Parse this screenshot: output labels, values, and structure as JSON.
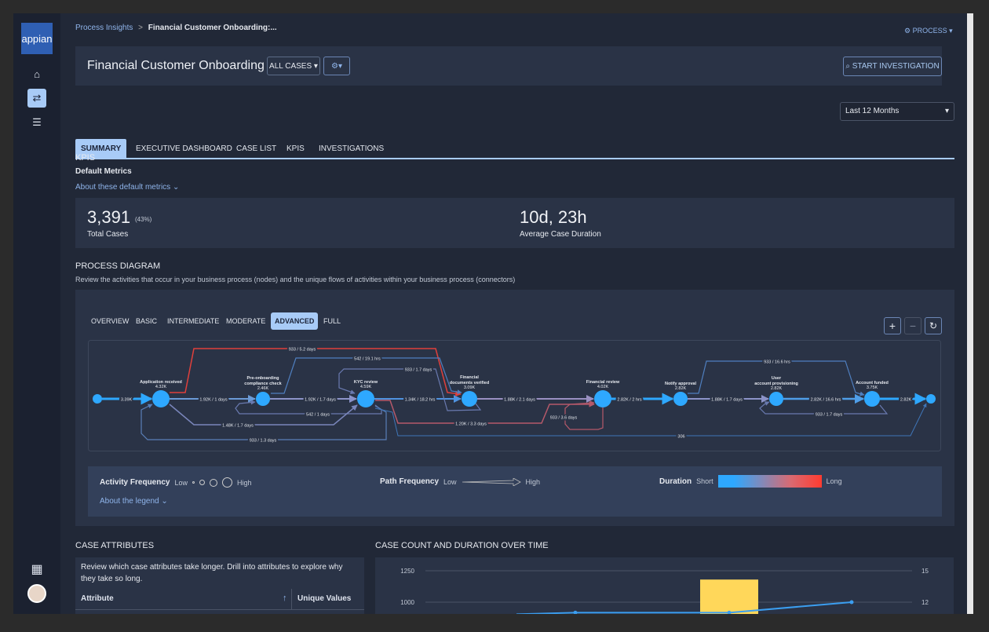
{
  "sidebar": {
    "logo": "appian",
    "items": [
      {
        "icon": "home-icon"
      },
      {
        "icon": "process-flow-icon",
        "active": true
      },
      {
        "icon": "database-icon"
      }
    ],
    "bottom": [
      {
        "icon": "apps-grid-icon"
      },
      {
        "icon": "user-avatar"
      }
    ]
  },
  "breadcrumb": {
    "parent": "Process Insights",
    "separator": ">",
    "current": "Financial Customer Onboarding:..."
  },
  "process_menu": "PROCESS",
  "header": {
    "title": "Financial Customer Onboarding",
    "filter": "ALL CASES",
    "start_investigation": "START INVESTIGATION"
  },
  "date_range": {
    "selected": "Last 12 Months"
  },
  "tabs": [
    {
      "label": "SUMMARY",
      "active": true
    },
    {
      "label": "EXECUTIVE DASHBOARD"
    },
    {
      "label": "CASE LIST"
    },
    {
      "label": "KPIS"
    },
    {
      "label": "INVESTIGATIONS"
    }
  ],
  "kpis": {
    "title": "KPIS",
    "subtitle": "Default Metrics",
    "about": "About these default metrics",
    "total": "3,391",
    "total_pct": "(43%)",
    "total_label": "Total Cases",
    "duration": "10d, 23h",
    "duration_label": "Average Case Duration"
  },
  "diagram": {
    "title": "PROCESS DIAGRAM",
    "description": "Review the activities that occur in your business process (nodes) and the unique flows of activities within your business process (connectors)",
    "levels": [
      {
        "label": "OVERVIEW"
      },
      {
        "label": "BASIC"
      },
      {
        "label": "INTERMEDIATE"
      },
      {
        "label": "MODERATE"
      },
      {
        "label": "ADVANCED",
        "active": true
      },
      {
        "label": "FULL"
      }
    ],
    "controls": {
      "zoom_in": "+",
      "zoom_out": "−",
      "reset": "↻"
    },
    "nodes": [
      {
        "name": "",
        "count": ""
      },
      {
        "name": "Application received",
        "count": "4.32K"
      },
      {
        "name": "Pre-onboarding|compliance check",
        "count": "2.46K"
      },
      {
        "name": "KYC review",
        "count": "4.59K"
      },
      {
        "name": "Financial|documents verified",
        "count": "3.09K"
      },
      {
        "name": "Financial review",
        "count": "4.02K"
      },
      {
        "name": "Notify approval",
        "count": "2.82K"
      },
      {
        "name": "User|account provisioning",
        "count": "2.82K"
      },
      {
        "name": "Account funded",
        "count": "3.75K"
      },
      {
        "name": "",
        "count": ""
      }
    ],
    "edges": [
      {
        "label": "3.39K",
        "color": "#2ea8ff"
      },
      {
        "label": "1.92K / 1 days",
        "color": "#6b9ad6"
      },
      {
        "label": "1.92K / 1.7 days",
        "color": "#8c93c8"
      },
      {
        "label": "1.34K / 18.2 hrs",
        "color": "#4f93e0"
      },
      {
        "label": "1.88K / 2.1 days",
        "color": "#9a90c2"
      },
      {
        "label": "2.82K / 2 hrs",
        "color": "#2ea8ff"
      },
      {
        "label": "1.88K / 1.7 days",
        "color": "#8c93c8"
      },
      {
        "label": "2.82K / 16.6 hrs",
        "color": "#4f9ee8"
      },
      {
        "label": "2.82K",
        "color": "#2ea8ff"
      },
      {
        "label": "933 / 5.2 days",
        "color": "#e0403c"
      },
      {
        "label": "542 / 19.1 hrs",
        "color": "#4f7fbf"
      },
      {
        "label": "933 / 1.7 days",
        "color": "#6a7ab0"
      },
      {
        "label": "542 / 1 days",
        "color": "#6a7ab0"
      },
      {
        "label": "1.48K / 1.7 days",
        "color": "#7a86bb"
      },
      {
        "label": "933 / 1.3 days",
        "color": "#5a7fb8"
      },
      {
        "label": "1.20K / 3.3 days",
        "color": "#b5596a"
      },
      {
        "label": "933 / 3.6 days",
        "color": "#b5596a"
      },
      {
        "label": "306",
        "color": "#3f76b8"
      },
      {
        "label": "933 / 16.6 hrs",
        "color": "#4f7fbf"
      },
      {
        "label": "933 / 1.7 days",
        "color": "#6a7ab0"
      }
    ],
    "legend": {
      "activity": "Activity Frequency",
      "path": "Path Frequency",
      "duration": "Duration",
      "low": "Low",
      "high": "High",
      "short": "Short",
      "long": "Long",
      "about": "About the legend",
      "gradient": [
        "#2ea8ff",
        "#ff3b30"
      ]
    }
  },
  "case_attributes": {
    "title": "CASE ATTRIBUTES",
    "description": "Review which case attributes take longer. Drill into attributes to explore why they take so long.",
    "columns": [
      "Attribute",
      "Unique Values"
    ]
  },
  "case_count_chart": {
    "title": "CASE COUNT AND DURATION OVER TIME",
    "left_ticks": [
      "1250",
      "1000"
    ],
    "right_ticks": [
      "15",
      "12"
    ],
    "bar_value": 1180,
    "line_values": [
      11.0,
      11.0,
      12.0
    ],
    "bar_color": "#ffd75a",
    "line_color": "#3b9ef0"
  }
}
